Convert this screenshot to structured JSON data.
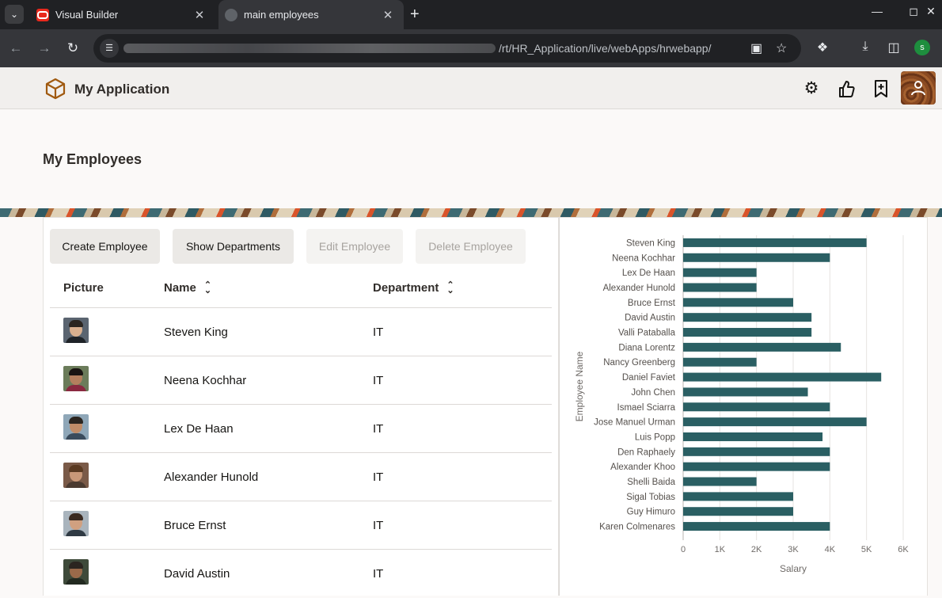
{
  "browser": {
    "tabs": [
      {
        "title": "Visual Builder",
        "active": false
      },
      {
        "title": "main employees",
        "active": true
      }
    ],
    "url_path": "/rt/HR_Application/live/webApps/hrwebapp/",
    "profile_initial": "s"
  },
  "app": {
    "name": "My Application",
    "page_title": "My Employees"
  },
  "toolbar": {
    "create": "Create Employee",
    "show_departments": "Show Departments",
    "edit": "Edit Employee",
    "delete": "Delete Employee"
  },
  "table": {
    "headers": {
      "picture": "Picture",
      "name": "Name",
      "department": "Department"
    },
    "rows": [
      {
        "name": "Steven King",
        "department": "IT"
      },
      {
        "name": "Neena Kochhar",
        "department": "IT"
      },
      {
        "name": "Lex De Haan",
        "department": "IT"
      },
      {
        "name": "Alexander Hunold",
        "department": "IT"
      },
      {
        "name": "Bruce Ernst",
        "department": "IT"
      },
      {
        "name": "David Austin",
        "department": "IT"
      }
    ]
  },
  "colors": {
    "bar": "#2a5f63",
    "accent": "#312d2a"
  },
  "chart_data": {
    "type": "bar",
    "orientation": "horizontal",
    "categories": [
      "Steven King",
      "Neena Kochhar",
      "Lex De Haan",
      "Alexander Hunold",
      "Bruce Ernst",
      "David Austin",
      "Valli Pataballa",
      "Diana Lorentz",
      "Nancy Greenberg",
      "Daniel Faviet",
      "John Chen",
      "Ismael Sciarra",
      "Jose Manuel Urman",
      "Luis Popp",
      "Den Raphaely",
      "Alexander Khoo",
      "Shelli Baida",
      "Sigal Tobias",
      "Guy Himuro",
      "Karen Colmenares"
    ],
    "values": [
      5000,
      4000,
      2000,
      2000,
      3000,
      3500,
      3500,
      4300,
      2000,
      5400,
      3400,
      4000,
      5000,
      3800,
      4000,
      4000,
      2000,
      3000,
      3000,
      4000
    ],
    "xlabel": "Salary",
    "ylabel": "Employee Name",
    "xlim": [
      0,
      6000
    ],
    "xticks": [
      "0",
      "1K",
      "2K",
      "3K",
      "4K",
      "5K",
      "6K"
    ],
    "grid": true
  }
}
